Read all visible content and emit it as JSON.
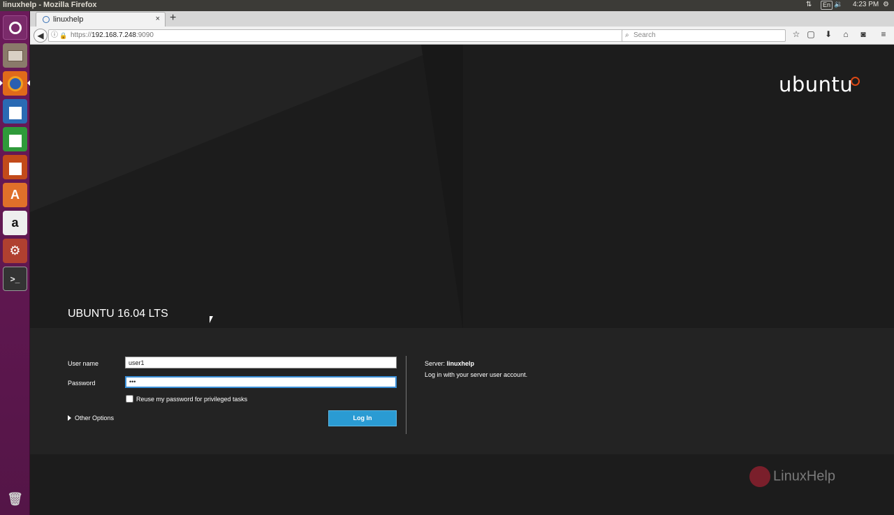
{
  "system_bar": {
    "window_title": "linuxhelp - Mozilla Firefox",
    "keyboard_layout": "En",
    "time": "4:23 PM"
  },
  "launcher": {
    "items": [
      {
        "name": "dash-home"
      },
      {
        "name": "files"
      },
      {
        "name": "firefox",
        "active": true
      },
      {
        "name": "libreoffice-writer"
      },
      {
        "name": "libreoffice-calc"
      },
      {
        "name": "libreoffice-impress"
      },
      {
        "name": "ubuntu-software-center"
      },
      {
        "name": "amazon"
      },
      {
        "name": "system-settings"
      },
      {
        "name": "terminal"
      },
      {
        "name": "trash"
      }
    ]
  },
  "browser": {
    "tab_title": "linuxhelp",
    "new_tab_label": "+",
    "tab_close": "×",
    "url_prefix": "https://",
    "url_host": "192.168.7.248",
    "url_port": ":9090",
    "search_placeholder": "Search"
  },
  "page": {
    "logo_text": "ubuntu",
    "os_name": "UBUNTU 16.04 LTS",
    "login": {
      "username_label": "User name",
      "username_value": "user1",
      "password_label": "Password",
      "password_value": "•••",
      "reuse_label": "Reuse my password for privileged tasks",
      "reuse_checked": false,
      "other_options": "Other Options",
      "login_button": "Log In"
    },
    "server_info": {
      "server_label": "Server:",
      "server_name": "linuxhelp",
      "hint": "Log in with your server user account."
    },
    "watermark": "LinuxHelp"
  },
  "colors": {
    "launcher_bg": "#5e1850",
    "login_button": "#2a9bd3",
    "logo_accent": "#dd4814"
  }
}
